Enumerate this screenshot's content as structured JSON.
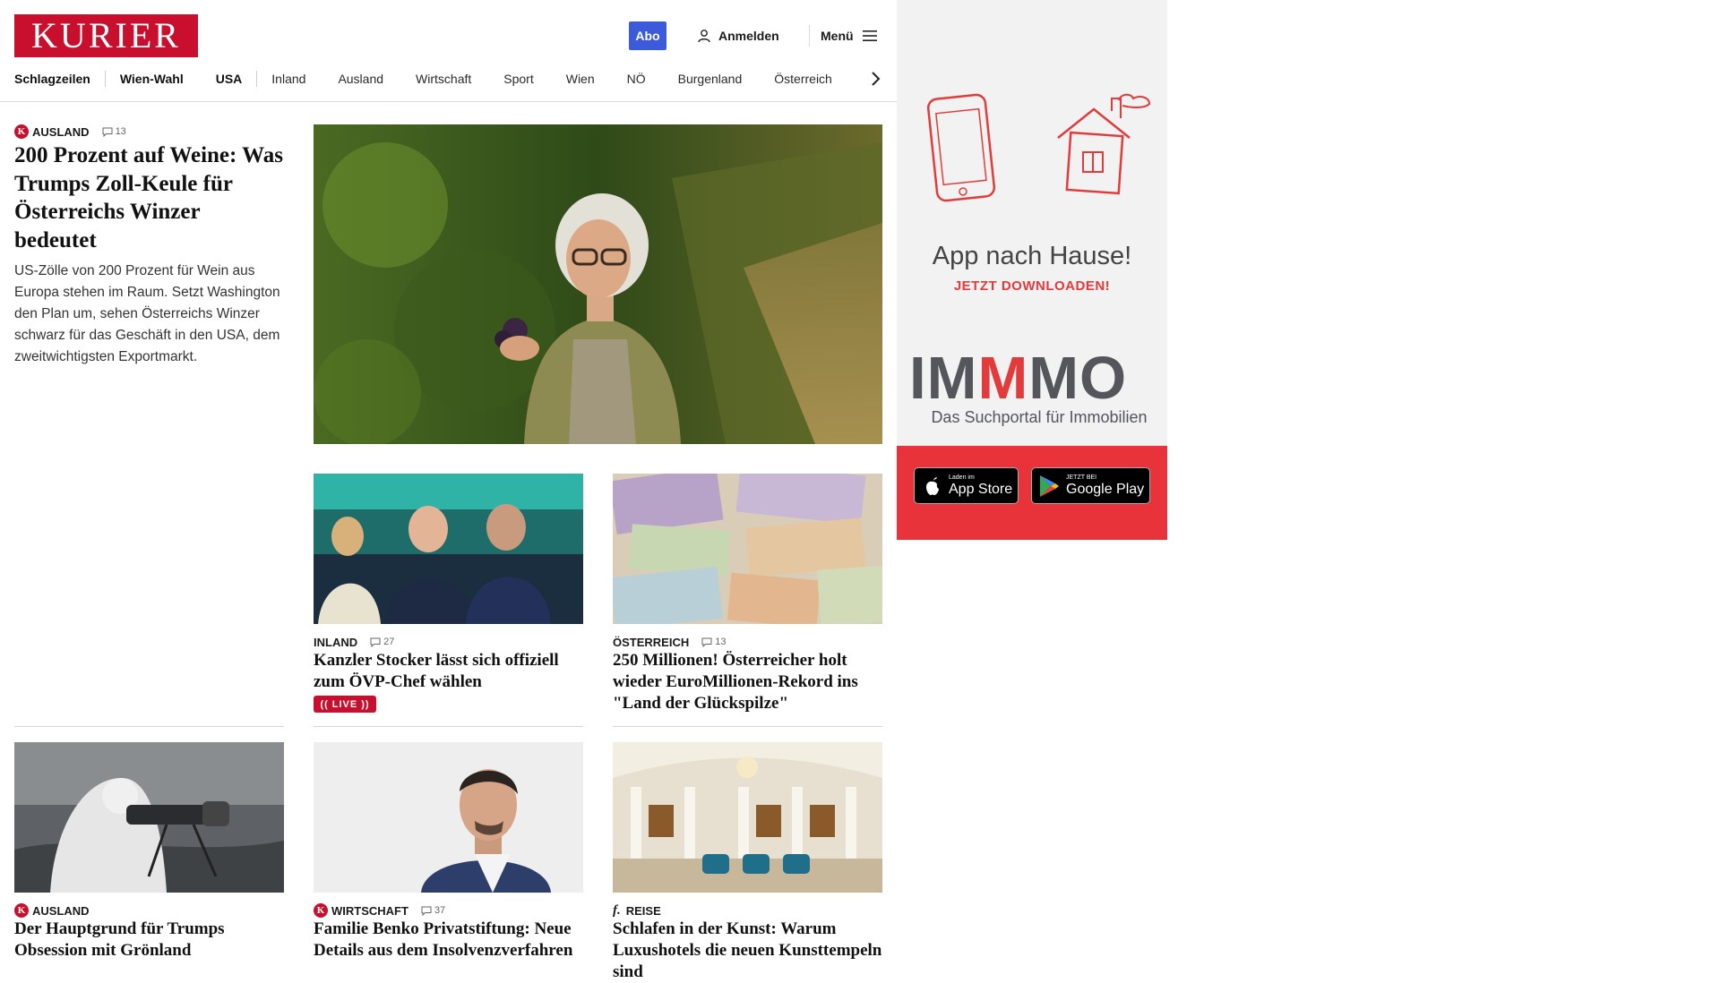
{
  "header": {
    "logo": "KURIER",
    "abo_label": "Abo",
    "login_label": "Anmelden",
    "menu_label": "Menü"
  },
  "nav": {
    "items": [
      "Schlagzeilen",
      "Wien-Wahl",
      "USA",
      "Inland",
      "Ausland",
      "Wirtschaft",
      "Sport",
      "Wien",
      "NÖ",
      "Burgenland",
      "Österreich"
    ]
  },
  "lead": {
    "category": "AUSLAND",
    "comments": "13",
    "title": "200 Prozent auf Weine: Was Trumps Zoll-Keule für Österreichs Winzer bedeutet",
    "teaser": "US-Zölle von 200 Prozent für Wein aus Europa stehen im Raum. Setzt Washington den Plan um, sehen Österreichs Winzer schwarz für das Geschäft in den USA, dem zweitwichtigsten Exportmarkt."
  },
  "cards": [
    {
      "category": "INLAND",
      "comments": "27",
      "title": "Kanzler Stocker lässt sich offiziell zum ÖVP-Chef wählen",
      "badge": "LIVE"
    },
    {
      "category": "ÖSTERREICH",
      "comments": "13",
      "title": "250 Millionen! Österreicher holt wieder EuroMillionen-Rekord ins \"Land der Glückspilze\""
    },
    {
      "category": "AUSLAND",
      "title": "Der Hauptgrund für Trumps Obsession mit Grönland"
    },
    {
      "category": "WIRTSCHAFT",
      "comments": "37",
      "title": "Familie Benko Privatstiftung: Neue Details aus dem Insolvenzverfahren"
    },
    {
      "category": "REISE",
      "title": "Schlafen in der Kunst: Warum Luxushotels die neuen Kunsttempeln sind"
    }
  ],
  "ad": {
    "headline": "App nach Hause!",
    "subline": "JETZT DOWNLOADEN!",
    "brand_im": "IM",
    "brand_m": "M",
    "brand_mo": "MO",
    "tagline": "Das Suchportal für Immobilien",
    "appstore_small": "Laden im",
    "appstore_big": "App Store",
    "googleplay_small": "JETZT BEI",
    "googleplay_big": "Google Play"
  },
  "colors": {
    "brand_red": "#c8102e",
    "abo_blue": "#3b5bdb",
    "ad_red": "#e8333b"
  }
}
